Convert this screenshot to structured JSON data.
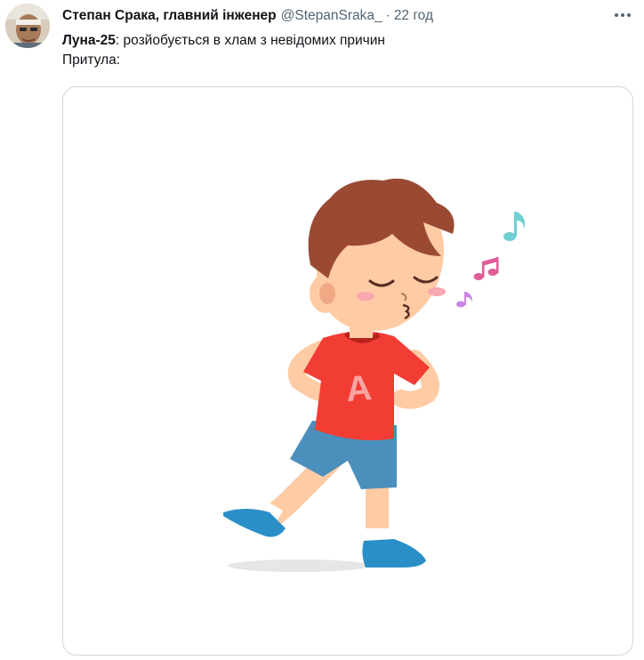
{
  "tweet": {
    "author_name": "Степан Срака, главний інженер",
    "handle": "@StepanSraka_",
    "separator": "·",
    "time": "22 год",
    "line1_bold": "Луна-25",
    "line1_rest": ": розйобується в хлам з невідомих причин",
    "line2": "Притула:"
  },
  "icons": {
    "more": "more-horizontal-icon",
    "avatar": "avatar"
  },
  "colors": {
    "text": "#0f1419",
    "muted": "#536471",
    "border": "#cfd9de",
    "shirt": "#f23d34",
    "shorts": "#4b8fbd",
    "hair": "#9a4a33",
    "shoe": "#2a8fc7",
    "skin": "#ffcba4",
    "note_teal": "#6fd0d2",
    "note_pink": "#e05c98",
    "note_purple": "#c986e2"
  },
  "media": {
    "alt": "Cartoon boy whistling and walking with music notes",
    "shirt_letter": "A"
  }
}
